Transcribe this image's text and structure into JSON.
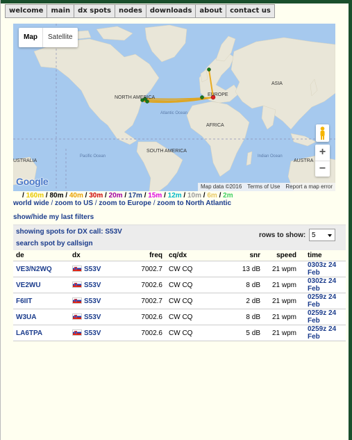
{
  "nav": {
    "items": [
      "welcome",
      "main",
      "dx spots",
      "nodes",
      "downloads",
      "about",
      "contact us"
    ]
  },
  "map": {
    "type_buttons": [
      "Map",
      "Satellite"
    ],
    "labels": {
      "north_america": "NORTH AMERICA",
      "europe": "EUROPE",
      "asia": "ASIA",
      "africa": "AFRICA",
      "south_america": "SOUTH AMERICA",
      "australia_left": "USTRALIA",
      "australia_right": "AUSTRA",
      "atlantic": "Atlantic Ocean",
      "pacific": "Pacific Ocean",
      "indian": "Indian Ocean"
    },
    "logo": "Google",
    "attribution": [
      "Map data ©2016",
      "Terms of Use",
      "Report a map error"
    ],
    "zoom_in": "+",
    "zoom_out": "−"
  },
  "bands": [
    {
      "label": "160m",
      "color": "#e8c800"
    },
    {
      "label": "80m",
      "color": "#000000"
    },
    {
      "label": "40m",
      "color": "#e8a000"
    },
    {
      "label": "30m",
      "color": "#cc0000"
    },
    {
      "label": "20m",
      "color": "#a000a0"
    },
    {
      "label": "17m",
      "color": "#1b3c8c"
    },
    {
      "label": "15m",
      "color": "#e000e0"
    },
    {
      "label": "12m",
      "color": "#00b8c8"
    },
    {
      "label": "10m",
      "color": "#9a9a9a"
    },
    {
      "label": "6m",
      "color": "#e8c860"
    },
    {
      "label": "2m",
      "color": "#40d060"
    }
  ],
  "zoom_links": [
    "world wide",
    "zoom to US",
    "zoom to Europe",
    "zoom to North Atlantic"
  ],
  "filters_link": "show/hide my last filters",
  "panel": {
    "showing": "showing spots for DX call:  S53V",
    "search": "search spot by callsign",
    "rows_label": "rows to show:",
    "rows_value": "5"
  },
  "table": {
    "headers": [
      "de",
      "dx",
      "freq",
      "cq/dx",
      "snr",
      "speed",
      "time"
    ],
    "rows": [
      {
        "de": "VE3/N2WQ",
        "dx": "S53V",
        "freq": "7002.7",
        "cq": "CW CQ",
        "snr": "13 dB",
        "speed": "21 wpm",
        "time": "0303z 24 Feb"
      },
      {
        "de": "VE2WU",
        "dx": "S53V",
        "freq": "7002.6",
        "cq": "CW CQ",
        "snr": "8 dB",
        "speed": "21 wpm",
        "time": "0302z 24 Feb"
      },
      {
        "de": "F6IIT",
        "dx": "S53V",
        "freq": "7002.7",
        "cq": "CW CQ",
        "snr": "2 dB",
        "speed": "21 wpm",
        "time": "0259z 24 Feb"
      },
      {
        "de": "W3UA",
        "dx": "S53V",
        "freq": "7002.6",
        "cq": "CW CQ",
        "snr": "8 dB",
        "speed": "21 wpm",
        "time": "0259z 24 Feb"
      },
      {
        "de": "LA6TPA",
        "dx": "S53V",
        "freq": "7002.6",
        "cq": "CW CQ",
        "snr": "5 dB",
        "speed": "21 wpm",
        "time": "0259z 24 Feb"
      }
    ]
  }
}
